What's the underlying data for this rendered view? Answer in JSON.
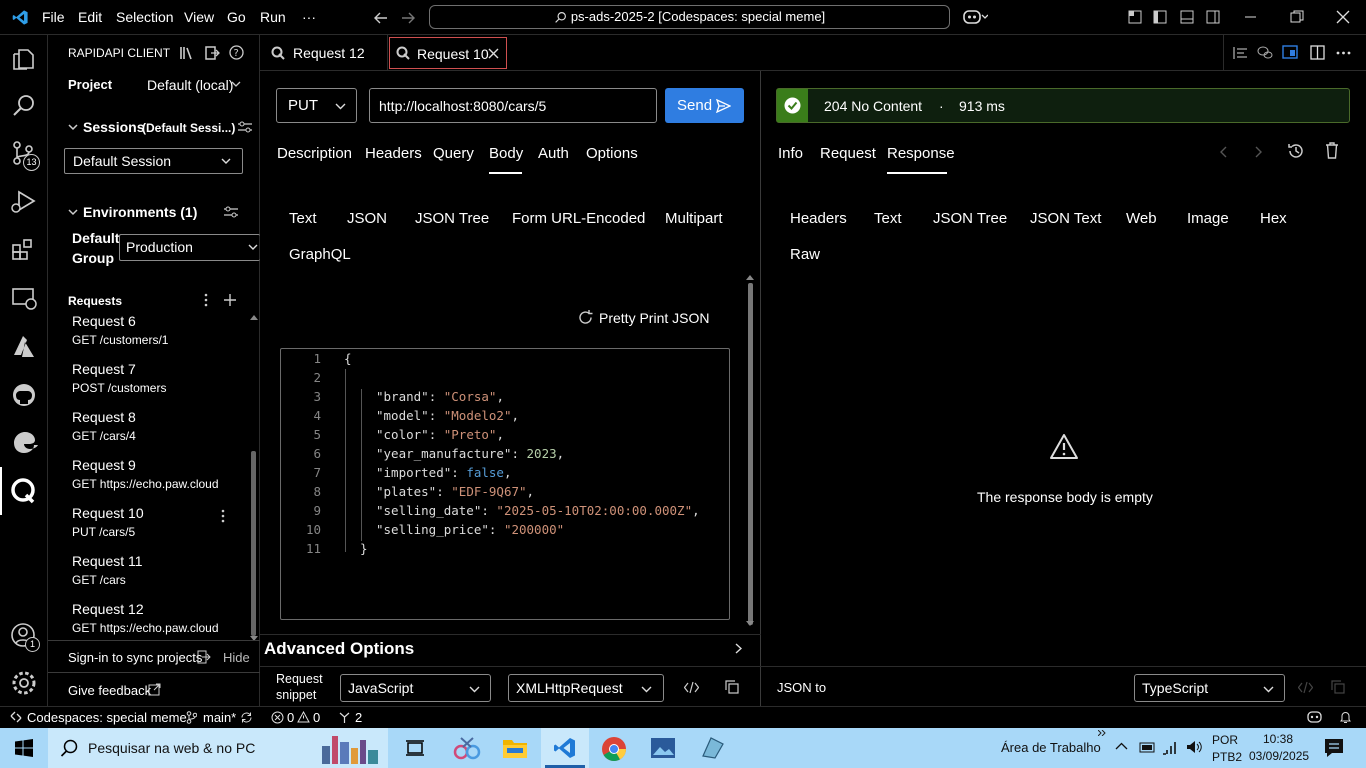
{
  "titlebar": {
    "menus": [
      "File",
      "Edit",
      "Selection",
      "View",
      "Go",
      "Run",
      "···"
    ],
    "command_center": "ps-ads-2025-2 [Codespaces: special meme]"
  },
  "activity": {
    "source_control_badge": "13",
    "accounts_badge": "1"
  },
  "sidebar": {
    "header": "RAPIDAPI CLIENT",
    "project_label": "Project",
    "project_value": "Default (local)",
    "sessions_label": "Sessions",
    "sessions_hint": "(Default Sessi...)",
    "session_value": "Default Session",
    "environments_label": "Environments (1)",
    "default_group_label_1": "Default",
    "default_group_label_2": "Group",
    "environment_value": "Production",
    "requests_label": "Requests",
    "requests": [
      {
        "name": "Request 6",
        "path": "GET /customers/1"
      },
      {
        "name": "Request 7",
        "path": "POST /customers"
      },
      {
        "name": "Request 8",
        "path": "GET /cars/4"
      },
      {
        "name": "Request 9",
        "path": "GET https://echo.paw.cloud"
      },
      {
        "name": "Request 10",
        "path": "PUT /cars/5"
      },
      {
        "name": "Request 11",
        "path": "GET /cars"
      },
      {
        "name": "Request 12",
        "path": "GET https://echo.paw.cloud"
      }
    ],
    "signin": "Sign-in to sync projects",
    "hide": "Hide",
    "feedback": "Give feedback"
  },
  "tabs": [
    {
      "label": "Request 12",
      "active": false
    },
    {
      "label": "Request 10",
      "active": true
    }
  ],
  "request": {
    "method": "PUT",
    "url": "http://localhost:8080/cars/5",
    "send": "Send",
    "tabs": [
      "Description",
      "Headers",
      "Query",
      "Body",
      "Auth",
      "Options"
    ],
    "active_tab": "Body",
    "body_types": [
      "Text",
      "JSON",
      "JSON Tree",
      "Form URL-Encoded",
      "Multipart",
      "GraphQL"
    ],
    "pretty_print": "Pretty Print JSON",
    "code": {
      "open": "{",
      "close": "}",
      "fields": [
        {
          "key": "\"brand\"",
          "value": "\"Corsa\"",
          "type": "str"
        },
        {
          "key": "\"model\"",
          "value": "\"Modelo2\"",
          "type": "str"
        },
        {
          "key": "\"color\"",
          "value": "\"Preto\"",
          "type": "str"
        },
        {
          "key": "\"year_manufacture\"",
          "value": "2023",
          "type": "num"
        },
        {
          "key": "\"imported\"",
          "value": "false",
          "type": "kw"
        },
        {
          "key": "\"plates\"",
          "value": "\"EDF-9Q67\"",
          "type": "str"
        },
        {
          "key": "\"selling_date\"",
          "value": "\"2025-05-10T02:00:00.000Z\"",
          "type": "str"
        },
        {
          "key": "\"selling_price\"",
          "value": "\"200000\"",
          "type": "str"
        }
      ]
    },
    "advanced": "Advanced Options",
    "snippet_label_1": "Request",
    "snippet_label_2": "snippet",
    "snippet_lang": "JavaScript",
    "snippet_lib": "XMLHttpRequest"
  },
  "response": {
    "status": "204 No Content",
    "sep": "·",
    "time": "913 ms",
    "tabs": [
      "Info",
      "Request",
      "Response"
    ],
    "active_tab": "Response",
    "view_types": [
      "Headers",
      "Text",
      "JSON Tree",
      "JSON Text",
      "Web",
      "Image",
      "Hex",
      "Raw"
    ],
    "empty_message": "The response body is empty",
    "json_to": "JSON to",
    "json_to_lang": "TypeScript"
  },
  "statusbar": {
    "remote": "Codespaces: special meme",
    "branch": "main*",
    "errors": "0",
    "warnings": "0",
    "ports": "2"
  },
  "taskbar": {
    "search": "Pesquisar na web & no PC",
    "desktop": "Área de Trabalho",
    "lang1": "POR",
    "lang2": "PTB2",
    "time": "10:38",
    "date": "03/09/2025"
  },
  "colors": {
    "accent": "#2f7de1",
    "success": "#4caf50",
    "status_bg": "#0e1f0e"
  }
}
